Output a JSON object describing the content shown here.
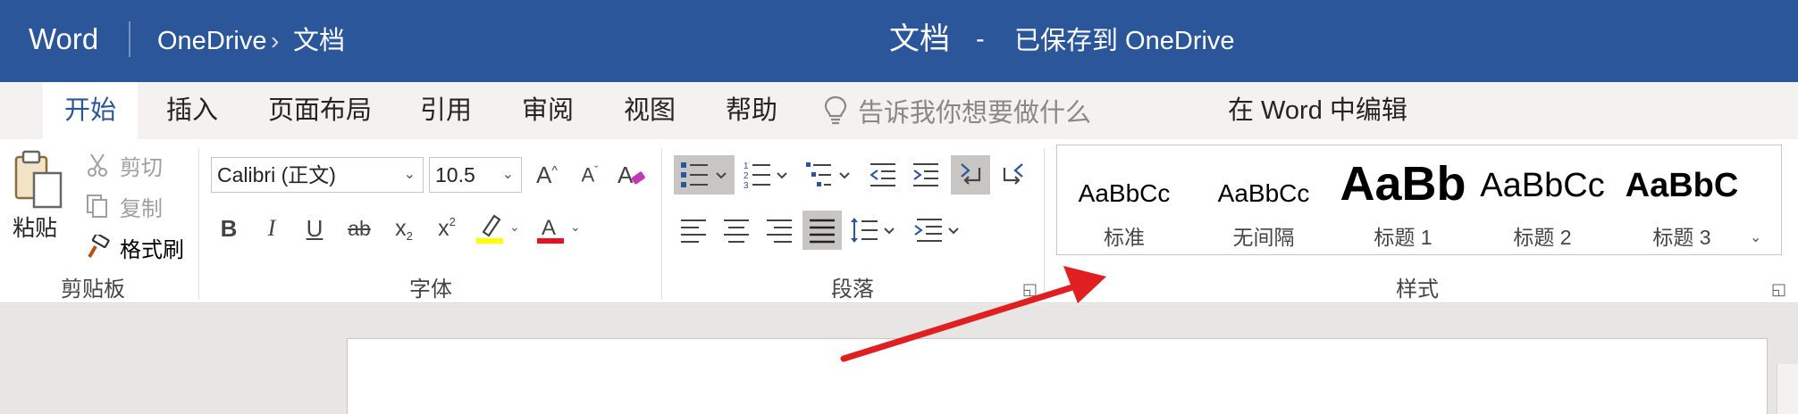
{
  "titlebar": {
    "app_name": "Word",
    "breadcrumb": [
      "OneDrive",
      "文档"
    ],
    "breadcrumb_sep": "›",
    "doc_title": "文档",
    "dash": "-",
    "save_status": "已保存到 OneDrive"
  },
  "tabs": {
    "items": [
      "开始",
      "插入",
      "页面布局",
      "引用",
      "审阅",
      "视图",
      "帮助"
    ],
    "active": "开始",
    "tell_me_placeholder": "告诉我你想要做什么",
    "edit_in_word": "在 Word 中编辑"
  },
  "clipboard": {
    "paste": "粘贴",
    "cut": "剪切",
    "copy": "复制",
    "format_painter": "格式刷",
    "group_label": "剪贴板"
  },
  "font": {
    "name": "Calibri (正文)",
    "size": "10.5",
    "group_label": "字体",
    "bold": "B",
    "italic": "I",
    "underline": "U",
    "strikethrough": "ab",
    "subscript": "x",
    "superscript": "x",
    "highlight_color": "#ffff00",
    "font_color": "#e81123"
  },
  "paragraph": {
    "group_label": "段落"
  },
  "styles": {
    "group_label": "样式",
    "items": [
      {
        "sample": "AaBbCc",
        "name": "标准"
      },
      {
        "sample": "AaBbCc",
        "name": "无间隔"
      },
      {
        "sample": "AaBb",
        "name": "标题 1"
      },
      {
        "sample": "AaBbCc",
        "name": "标题 2"
      },
      {
        "sample": "AaBbC",
        "name": "标题 3"
      }
    ]
  },
  "colors": {
    "brand": "#2b579a",
    "annotation_arrow": "#e02020"
  }
}
